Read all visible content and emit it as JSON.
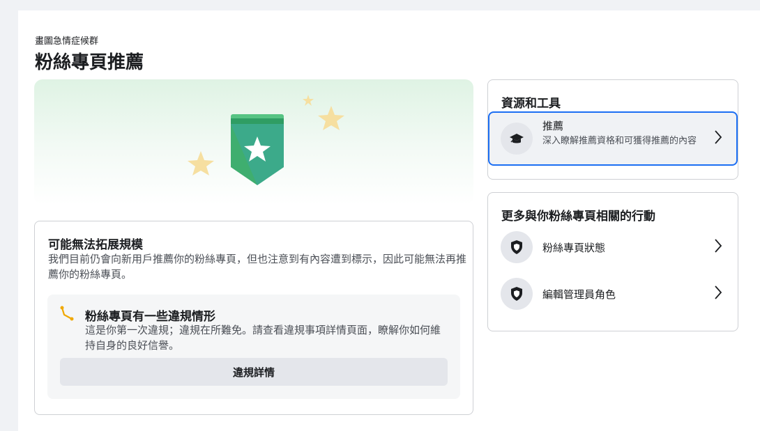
{
  "page": {
    "subtitle": "畫圖急情症候群",
    "title": "粉絲專頁推薦"
  },
  "warning": {
    "title": "可能無法拓展規模",
    "description": "我們目前仍會向新用戶推薦你的粉絲專頁，但也注意到有內容遭到標示，因此可能無法再推薦你的粉絲專頁。",
    "violation": {
      "title": "粉絲專頁有一些違規情形",
      "description": "這是你第一次違規；違規在所難免。請查看違規事項詳情頁面，瞭解你如何維持自身的良好信譽。",
      "button_label": "違規詳情"
    }
  },
  "resources": {
    "heading": "資源和工具",
    "items": [
      {
        "label": "推薦",
        "description": "深入瞭解推薦資格和可獲得推薦的內容",
        "icon": "graduation-cap-icon"
      }
    ]
  },
  "actions": {
    "heading": "更多與你粉絲專頁相關的行動",
    "items": [
      {
        "label": "粉絲專頁狀態",
        "icon": "shield-icon"
      },
      {
        "label": "編輯管理員角色",
        "icon": "shield-icon"
      }
    ]
  },
  "colors": {
    "accent_blue": "#1b6ef3",
    "badge_green": "#3fae6f",
    "badge_teal": "#3aa7a0",
    "star_yellow": "#f6dfa0",
    "warning_orange": "#f0a800"
  }
}
